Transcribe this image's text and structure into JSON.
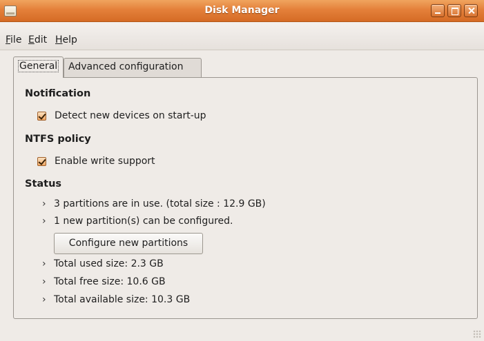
{
  "window": {
    "title": "Disk Manager"
  },
  "menubar": {
    "file": {
      "mnemonic": "F",
      "rest": "ile"
    },
    "edit": {
      "mnemonic": "E",
      "rest": "dit"
    },
    "help": {
      "mnemonic": "H",
      "rest": "elp"
    }
  },
  "tabs": [
    {
      "label": "General",
      "selected": true
    },
    {
      "label": "Advanced configuration",
      "selected": false
    }
  ],
  "general": {
    "notification": {
      "title": "Notification",
      "option_label": "Detect new devices on start-up",
      "checked": true
    },
    "ntfs": {
      "title": "NTFS policy",
      "option_label": "Enable write support",
      "checked": true
    },
    "status": {
      "title": "Status",
      "partitions_in_use": "3 partitions are in use. (total size : 12.9 GB)",
      "new_partitions": "1 new partition(s) can be configured.",
      "configure_button": "Configure new partitions",
      "used_size": "Total used size: 2.3 GB",
      "free_size": "Total free size: 10.6 GB",
      "available_size": "Total available size: 10.3 GB"
    }
  },
  "icons": {
    "arrow": "›",
    "app": "window-icon",
    "minimize": "minimize-icon",
    "maximize": "maximize-icon",
    "close": "close-icon"
  },
  "colors": {
    "titlebar": "#e4803a",
    "window_bg": "#efebe7",
    "checkbox_accent": "#f0a764"
  }
}
